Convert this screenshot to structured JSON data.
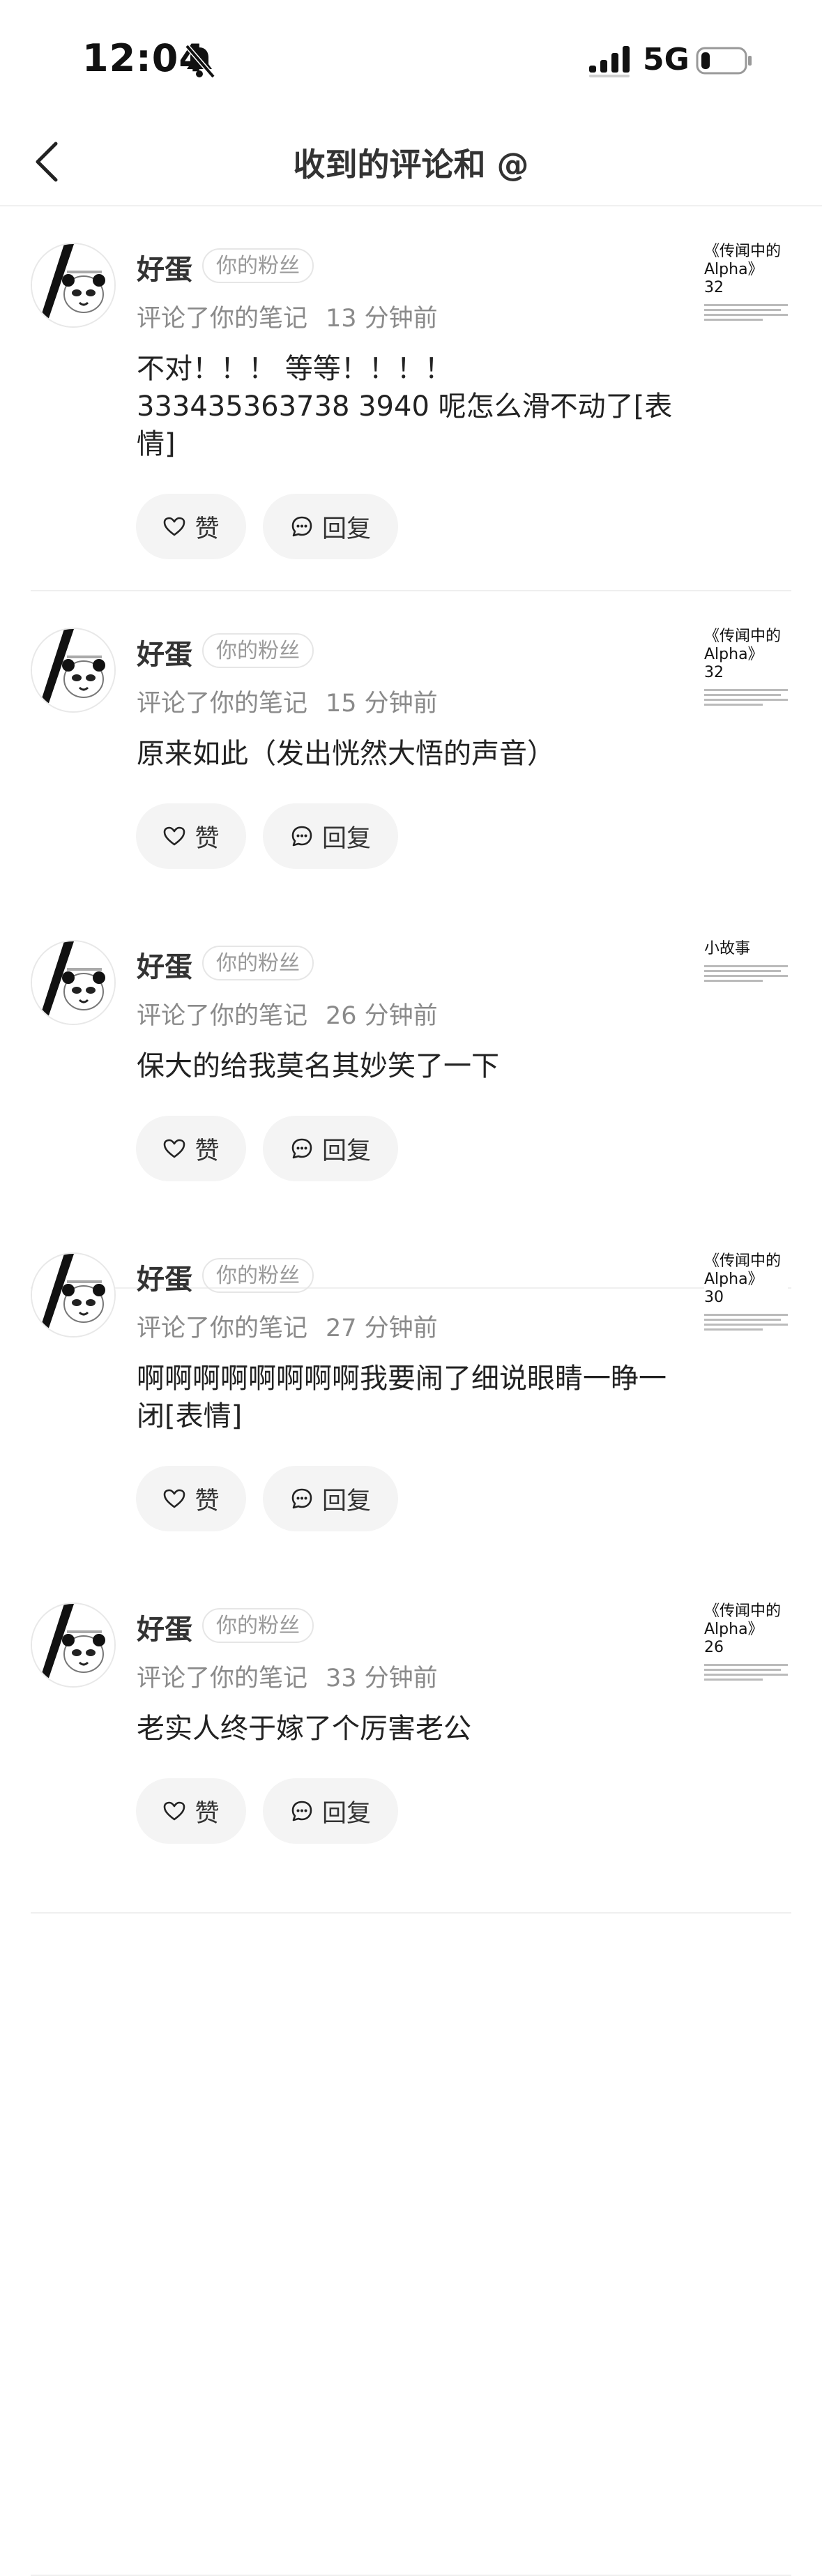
{
  "status_bar": {
    "time": "12:04",
    "network": "5G"
  },
  "nav": {
    "title": "收到的评论和 @"
  },
  "comments": [
    {
      "user": "好蛋",
      "badge": "你的粉丝",
      "action": "评论了你的笔记",
      "time": "13 分钟前",
      "text": "不对！！！ 等等！！！！\n333435363738 3940 呢怎么滑不动了[表情]",
      "like": "赞",
      "reply": "回复",
      "thumb_title": "《传闻中的\nAlpha》\n32"
    },
    {
      "user": "好蛋",
      "badge": "你的粉丝",
      "action": "评论了你的笔记",
      "time": "15 分钟前",
      "text": "原来如此（发出恍然大悟的声音）",
      "like": "赞",
      "reply": "回复",
      "thumb_title": "《传闻中的\nAlpha》\n32"
    },
    {
      "user": "好蛋",
      "badge": "你的粉丝",
      "action": "评论了你的笔记",
      "time": "26 分钟前",
      "text": "保大的给我莫名其妙笑了一下",
      "like": "赞",
      "reply": "回复",
      "thumb_title": "小故事"
    },
    {
      "user": "好蛋",
      "badge": "你的粉丝",
      "action": "评论了你的笔记",
      "time": "27 分钟前",
      "text": "啊啊啊啊啊啊啊啊我要闹了细说眼睛一睁一闭[表情]",
      "like": "赞",
      "reply": "回复",
      "thumb_title": "《传闻中的\nAlpha》\n30"
    },
    {
      "user": "好蛋",
      "badge": "你的粉丝",
      "action": "评论了你的笔记",
      "time": "33 分钟前",
      "text": "老实人终于嫁了个厉害老公",
      "like": "赞",
      "reply": "回复",
      "thumb_title": "《传闻中的\nAlpha》\n26"
    }
  ]
}
